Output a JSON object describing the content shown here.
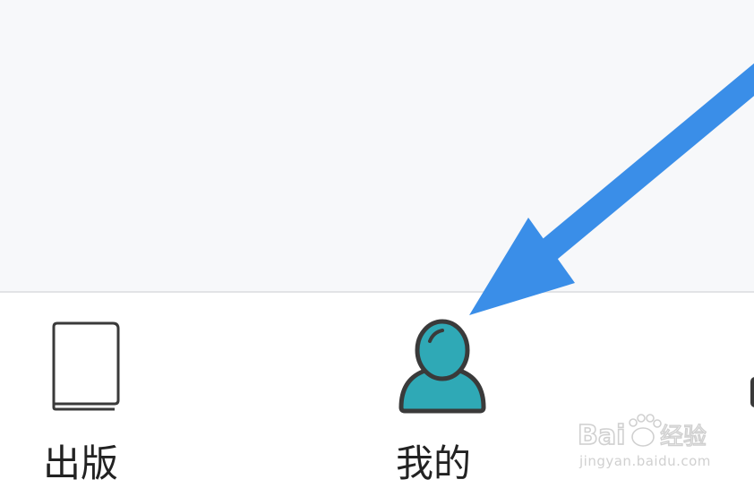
{
  "tabbar": {
    "tabs": [
      {
        "label": "出版",
        "icon": "book-icon"
      },
      {
        "label": "我的",
        "icon": "user-icon"
      },
      {
        "label": "",
        "icon": "partial-icon"
      }
    ]
  },
  "colors": {
    "content_bg": "#f7f8fa",
    "tabbar_bg": "#ffffff",
    "active_icon": "#2fa9b6",
    "icon_outline": "#3a3a3a",
    "arrow": "#3a8ee8"
  },
  "watermark": {
    "brand": "Bai du 经验",
    "site": "jingyan.baidu.com"
  }
}
